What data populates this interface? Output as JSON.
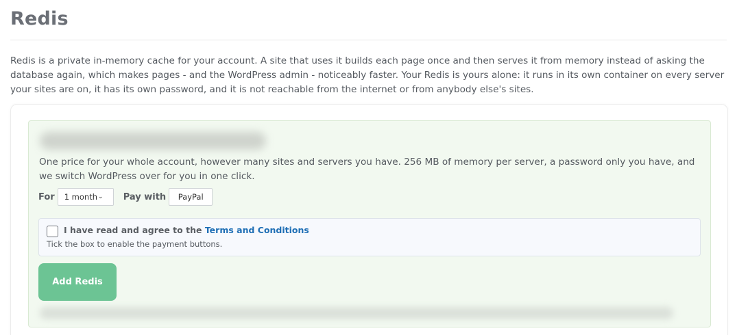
{
  "page": {
    "title": "Redis",
    "intro": "Redis is a private in-memory cache for your account. A site that uses it builds each page once and then serves it from memory instead of asking the database again, which makes pages - and the WordPress admin - noticeably faster. Your Redis is yours alone: it runs in its own container on every server your sites are on, it has its own password, and it is not reachable from the internet or from anybody else's sites."
  },
  "offer": {
    "description": "One price for your whole account, however many sites and servers you have. 256 MB of memory per server, a password only you have, and we switch WordPress over for you in one click.",
    "period_label": "For",
    "period_value": "1 month",
    "payment_label": "Pay with",
    "payment_value": "PayPal",
    "terms": {
      "prefix": "I have read and agree to the ",
      "link_text": "Terms and Conditions",
      "checked": false,
      "hint": "Tick the box to enable the payment buttons."
    },
    "add_button_label": "Add Redis"
  },
  "colors": {
    "accent_green": "#6cc494",
    "link_blue": "#1f6fb5",
    "offer_background": "#f2f9f0"
  }
}
